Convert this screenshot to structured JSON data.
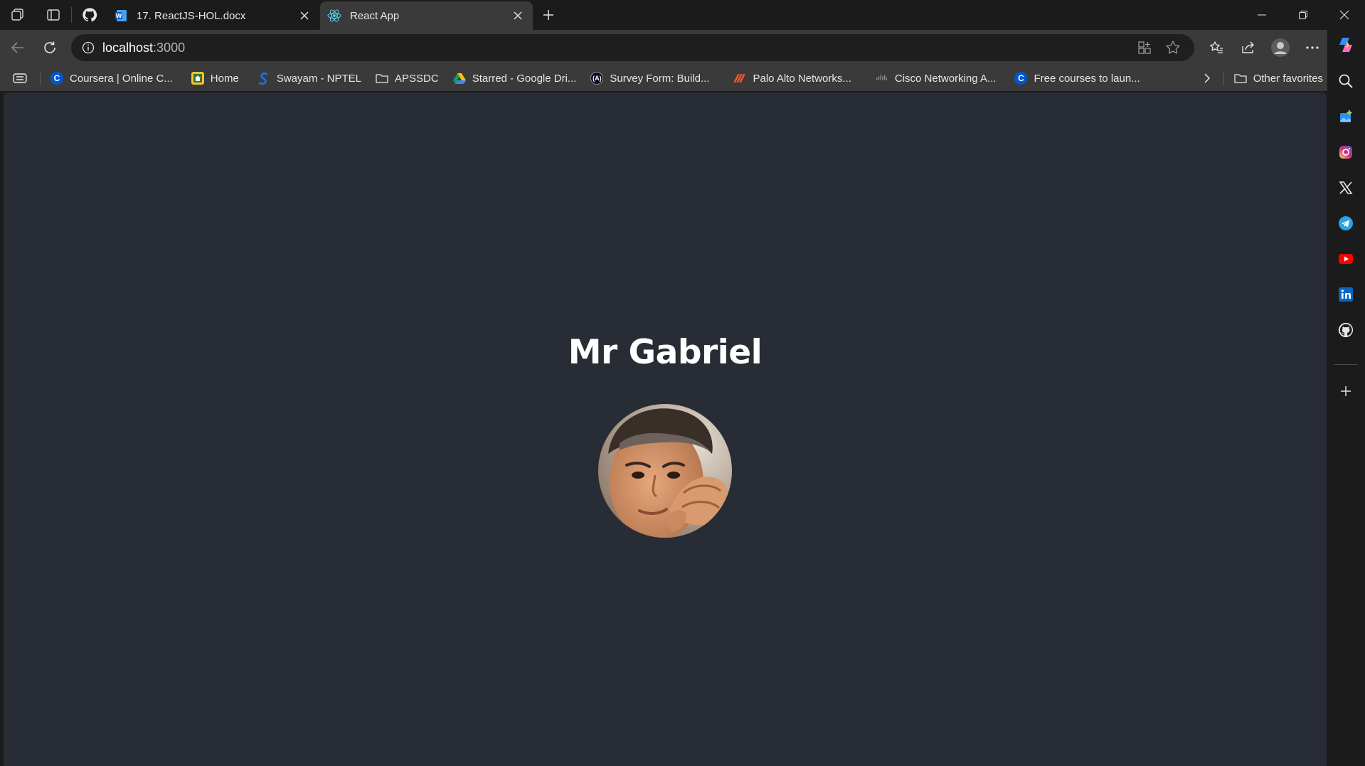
{
  "tabs": [
    {
      "title": "17. ReactJS-HOL.docx",
      "icon": "word-icon"
    },
    {
      "title": "React App",
      "icon": "react-icon",
      "active": true
    }
  ],
  "address_bar": {
    "host": "localhost",
    "port": ":3000"
  },
  "favorites": [
    {
      "label": "Coursera | Online C...",
      "icon": "coursera-icon"
    },
    {
      "label": "Home",
      "icon": "home-icon"
    },
    {
      "label": "Swayam - NPTEL",
      "icon": "swayam-icon"
    },
    {
      "label": "APSSDC",
      "icon": "folder-icon"
    },
    {
      "label": "Starred - Google Dri...",
      "icon": "google-drive-icon"
    },
    {
      "label": "Survey Form: Build...",
      "icon": "freecodecamp-icon"
    },
    {
      "label": "Palo Alto Networks...",
      "icon": "palo-alto-icon"
    },
    {
      "label": "Cisco Networking A...",
      "icon": "cisco-icon"
    },
    {
      "label": "Free courses to laun...",
      "icon": "coursera-icon"
    }
  ],
  "other_favorites": "Other favorites",
  "page": {
    "heading": "Mr Gabriel",
    "avatar_alt": "profile-photo"
  },
  "sidebar": {
    "items": [
      "search-icon",
      "copilot-image-icon",
      "instagram-icon",
      "x-icon",
      "telegram-icon",
      "youtube-icon",
      "linkedin-icon",
      "github-icon",
      "add-icon"
    ]
  },
  "colors": {
    "content_bg": "#282c34",
    "chrome_dark": "#1b1b1b",
    "chrome_mid": "#3a3a3a"
  }
}
